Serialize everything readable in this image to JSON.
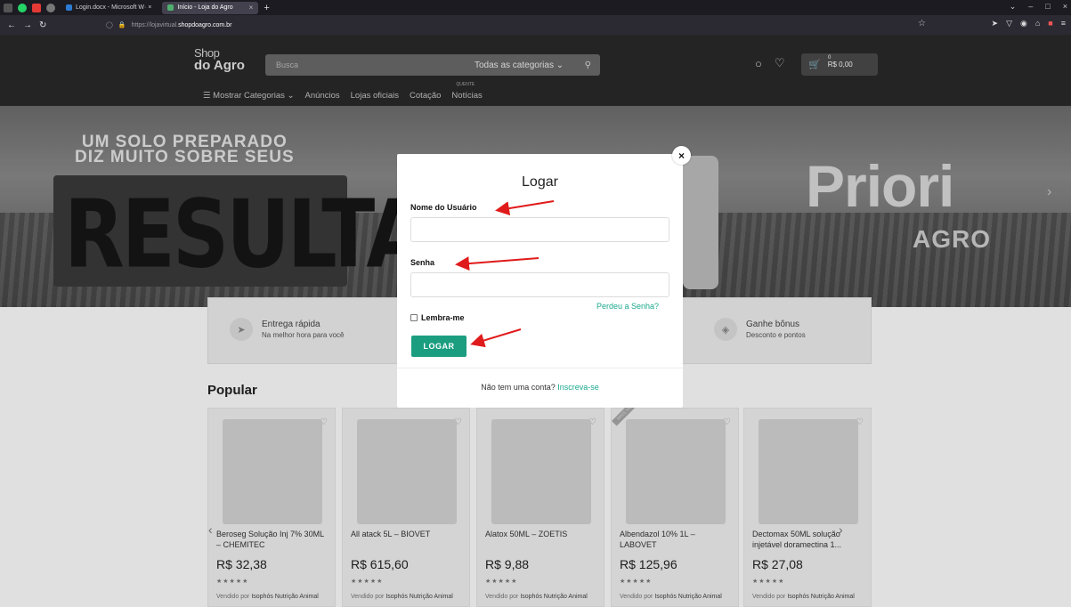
{
  "browser": {
    "tabs": [
      {
        "label": "Login.docx - Microsoft W· ×",
        "active": false
      },
      {
        "label": "Início - Loja do Agro",
        "active": true
      }
    ],
    "close_tab": "×",
    "new_tab": "+",
    "url_scheme": "https://lojavirtual.",
    "url_host": "shopdoagro.com.br"
  },
  "site": {
    "logo_line1": "Shop",
    "logo_line2": "do Agro",
    "search_placeholder": "Busca",
    "categories_select": "Todas as categorias",
    "cart_badge": "0",
    "cart_total": "R$ 0,00",
    "nav": [
      "☰ Mostrar Categorias ⌄",
      "Anúncios",
      "Lojas oficiais",
      "Cotação",
      "Notícias"
    ],
    "hot_badge": "QUENTE"
  },
  "hero": {
    "headline_line1": "UM SOLO PREPARADO",
    "headline_line2": "DIZ MUITO SOBRE SEUS",
    "big_word": "RESULTADOS",
    "brand": "Priori",
    "brand_sub": "AGRO"
  },
  "features": [
    {
      "icon": "send-icon",
      "title": "Entrega rápida",
      "subtitle": "Na melhor hora para você"
    },
    {
      "icon": "tag-icon",
      "title": "Ganhe bônus",
      "subtitle": "Desconto e pontos"
    }
  ],
  "popular_heading": "Popular",
  "products": [
    {
      "name": "Beroseg Solução Inj 7% 30ML – CHEMITEC",
      "price": "R$ 32,38",
      "stars": "★★★★★",
      "sold_by": "Vendido por",
      "seller": "Isophós Nutrição Animal"
    },
    {
      "name": "All atack 5L – BIOVET",
      "price": "R$ 615,60",
      "stars": "★★★★★",
      "sold_by": "Vendido por",
      "seller": "Isophós Nutrição Animal"
    },
    {
      "name": "Alatox 50ML – ZOETIS",
      "price": "R$ 9,88",
      "stars": "★★★★★",
      "sold_by": "Vendido por",
      "seller": "Isophós Nutrição Animal"
    },
    {
      "name": "Albendazol 10% 1L – LABOVET",
      "price": "R$ 125,96",
      "stars": "★★★★★",
      "sold_by": "Vendido por",
      "seller": "Isophós Nutrição Animal"
    },
    {
      "name": "Dectomax 50ML solução injetável doramectina 1...",
      "price": "R$ 27,08",
      "stars": "★★★★★",
      "sold_by": "Vendido por",
      "seller": "Isophós Nutrição Animal"
    }
  ],
  "ribbon": "MAIS VENDIDO",
  "modal": {
    "title": "Logar",
    "username_label": "Nome do Usuário",
    "username_value": "",
    "password_label": "Senha",
    "password_value": "",
    "forgot_link": "Perdeu a Senha?",
    "remember_label": "Lembra-me",
    "remember_checked": false,
    "login_button": "LOGAR",
    "no_account_text": "Não tem uma conta?",
    "signup_link": "Inscreva-se",
    "close_symbol": "×"
  },
  "colors": {
    "accent_green": "#1b9d80",
    "link_green": "#1aa88d",
    "annotation_red": "#e01b1b",
    "header_dark": "#2a2a2a"
  }
}
